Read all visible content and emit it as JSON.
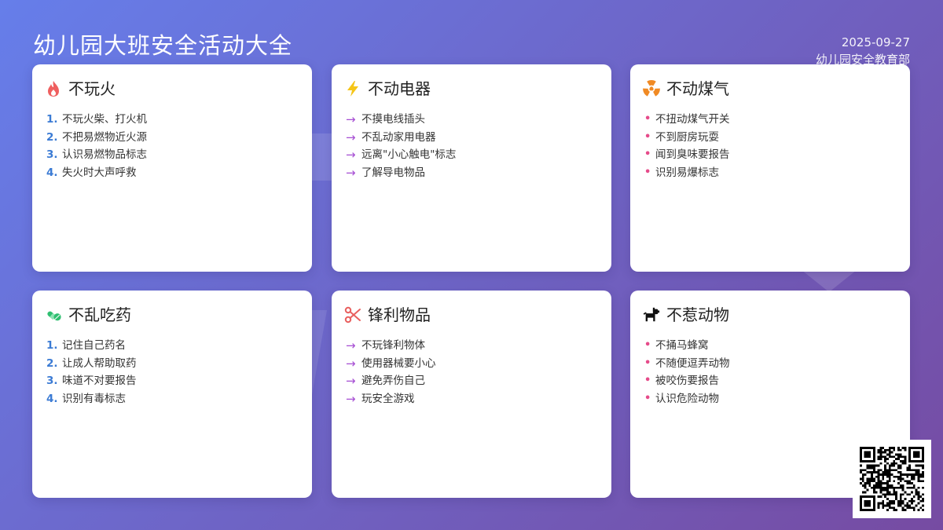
{
  "header": {
    "title": "幼儿园大班安全活动大全",
    "date": "2025-09-27",
    "org": "幼儿园安全教育部"
  },
  "colors": {
    "bg_start": "#667eea",
    "bg_end": "#764ba2",
    "number_marker": "#3b7bd4",
    "arrow_marker": "#a64ed3",
    "dot_marker": "#e64b8a"
  },
  "cards": [
    {
      "title": "不玩火",
      "icon": "fire-icon",
      "marker": "number",
      "items": [
        "不玩火柴、打火机",
        "不把易燃物近火源",
        "认识易燃物品标志",
        "失火时大声呼救"
      ]
    },
    {
      "title": "不动电器",
      "icon": "lightning-icon",
      "marker": "arrow",
      "items": [
        "不摸电线插头",
        "不乱动家用电器",
        "远离\"小心触电\"标志",
        "了解导电物品"
      ]
    },
    {
      "title": "不动煤气",
      "icon": "radiation-icon",
      "marker": "dot",
      "items": [
        "不扭动煤气开关",
        "不到厨房玩耍",
        "闻到臭味要报告",
        "识别易爆标志"
      ]
    },
    {
      "title": "不乱吃药",
      "icon": "pills-icon",
      "marker": "number",
      "items": [
        "记住自己药名",
        "让成人帮助取药",
        "味道不对要报告",
        "识别有毒标志"
      ]
    },
    {
      "title": "锋利物品",
      "icon": "scissors-icon",
      "marker": "arrow",
      "items": [
        "不玩锋利物体",
        "使用器械要小心",
        "避免弄伤自己",
        "玩安全游戏"
      ]
    },
    {
      "title": "不惹动物",
      "icon": "dog-icon",
      "marker": "dot",
      "items": [
        "不捅马蜂窝",
        "不随便逗弄动物",
        "被咬伤要报告",
        "认识危险动物"
      ]
    }
  ],
  "markers": {
    "arrow": "→",
    "dot": "•"
  },
  "qr": {
    "icon": "qr-code-icon"
  }
}
